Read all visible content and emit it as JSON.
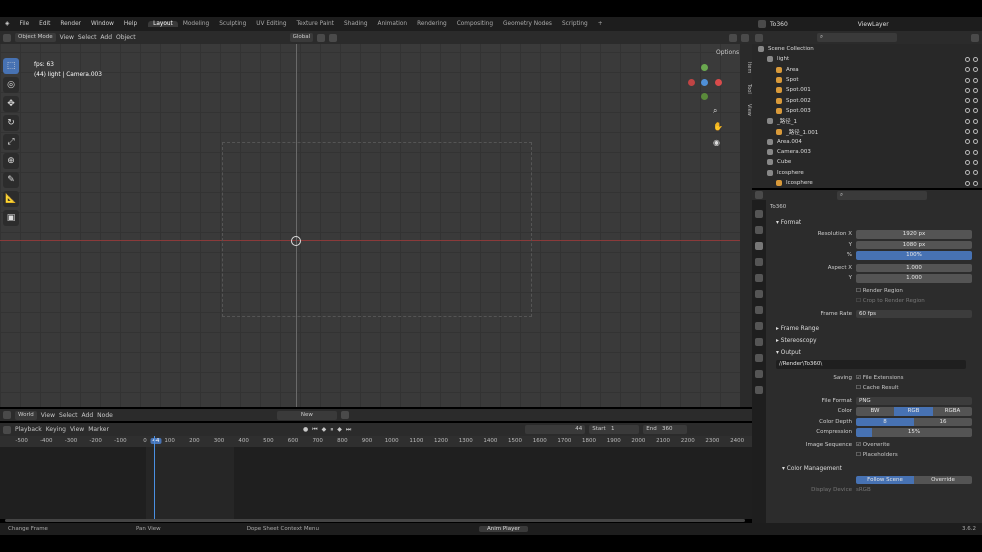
{
  "menu": {
    "items": [
      "File",
      "Edit",
      "Render",
      "Window",
      "Help"
    ]
  },
  "workspaces": [
    "Layout",
    "Modeling",
    "Sculpting",
    "UV Editing",
    "Texture Paint",
    "Shading",
    "Animation",
    "Rendering",
    "Compositing",
    "Geometry Nodes",
    "Scripting",
    "+"
  ],
  "scene": {
    "name": "To360"
  },
  "view_layer": {
    "name": "ViewLayer"
  },
  "viewport": {
    "mode": "Object Mode",
    "view": "View",
    "select": "Select",
    "add": "Add",
    "object": "Object",
    "orientation": "Global",
    "options": "Options",
    "fps": "fps: 63",
    "camera_info": "(44) light | Camera.003",
    "side_tabs": [
      "Item",
      "Tool",
      "View"
    ]
  },
  "outliner": {
    "rows": [
      {
        "label": "Scene Collection",
        "indent": 0
      },
      {
        "label": "light",
        "indent": 1
      },
      {
        "label": "Area",
        "indent": 2
      },
      {
        "label": "Spot",
        "indent": 2
      },
      {
        "label": "Spot.001",
        "indent": 2
      },
      {
        "label": "Spot.002",
        "indent": 2
      },
      {
        "label": "Spot.003",
        "indent": 2
      },
      {
        "label": "_路径_1",
        "indent": 1
      },
      {
        "label": "_路径_1.001",
        "indent": 2
      },
      {
        "label": "Area.004",
        "indent": 1
      },
      {
        "label": "Camera.003",
        "indent": 1
      },
      {
        "label": "Cube",
        "indent": 1
      },
      {
        "label": "Icosphere",
        "indent": 1
      },
      {
        "label": "Icosphere",
        "indent": 2
      },
      {
        "label": "Icosphere.001",
        "indent": 1
      }
    ]
  },
  "properties": {
    "title": "To360",
    "format_section": "Format",
    "resolution_x_label": "Resolution X",
    "resolution_x": "1920 px",
    "resolution_y_label": "Y",
    "resolution_y": "1080 px",
    "percent_label": "%",
    "percent": "100%",
    "aspect_x_label": "Aspect X",
    "aspect_x": "1.000",
    "aspect_y_label": "Y",
    "aspect_y": "1.000",
    "render_region": "Render Region",
    "crop_region": "Crop to Render Region",
    "frame_rate_label": "Frame Rate",
    "frame_rate": "60 fps",
    "frame_range_section": "Frame Range",
    "stereoscopy_section": "Stereoscopy",
    "output_section": "Output",
    "output_path": "//Render\\To360\\",
    "saving_label": "Saving",
    "file_extensions": "File Extensions",
    "cache_result": "Cache Result",
    "file_format_label": "File Format",
    "file_format": "PNG",
    "color_label": "Color",
    "color_options": [
      "BW",
      "RGB",
      "RGBA"
    ],
    "color_depth_label": "Color Depth",
    "color_depth_options": [
      "8",
      "16"
    ],
    "compression_label": "Compression",
    "compression": "15%",
    "image_sequence_label": "Image Sequence",
    "overwrite": "Overwrite",
    "placeholders": "Placeholders",
    "color_management_section": "Color Management",
    "cm_options": [
      "Follow Scene",
      "Override"
    ],
    "display_device_label": "Display Device",
    "display_device": "sRGB"
  },
  "timeline": {
    "editor_menu": [
      "World",
      "View",
      "Select",
      "Add",
      "Node"
    ],
    "new_label": "New",
    "controls": [
      "Playback",
      "Keying",
      "View",
      "Marker"
    ],
    "current_frame": "44",
    "start_label": "Start",
    "start": "1",
    "end_label": "End",
    "end": "360",
    "ruler": [
      "-500",
      "-400",
      "-300",
      "-200",
      "-100",
      "0",
      "44",
      "100",
      "200",
      "300",
      "400",
      "500",
      "600",
      "700",
      "800",
      "900",
      "1000",
      "1100",
      "1200",
      "1300",
      "1400",
      "1500",
      "1600",
      "1700",
      "1800",
      "1900",
      "2000",
      "2100",
      "2200",
      "2300",
      "2400"
    ]
  },
  "status": {
    "items": [
      "Change Frame",
      "Pan View",
      "Dope Sheet Context Menu",
      "Anim Player"
    ],
    "version": "3.6.2"
  }
}
